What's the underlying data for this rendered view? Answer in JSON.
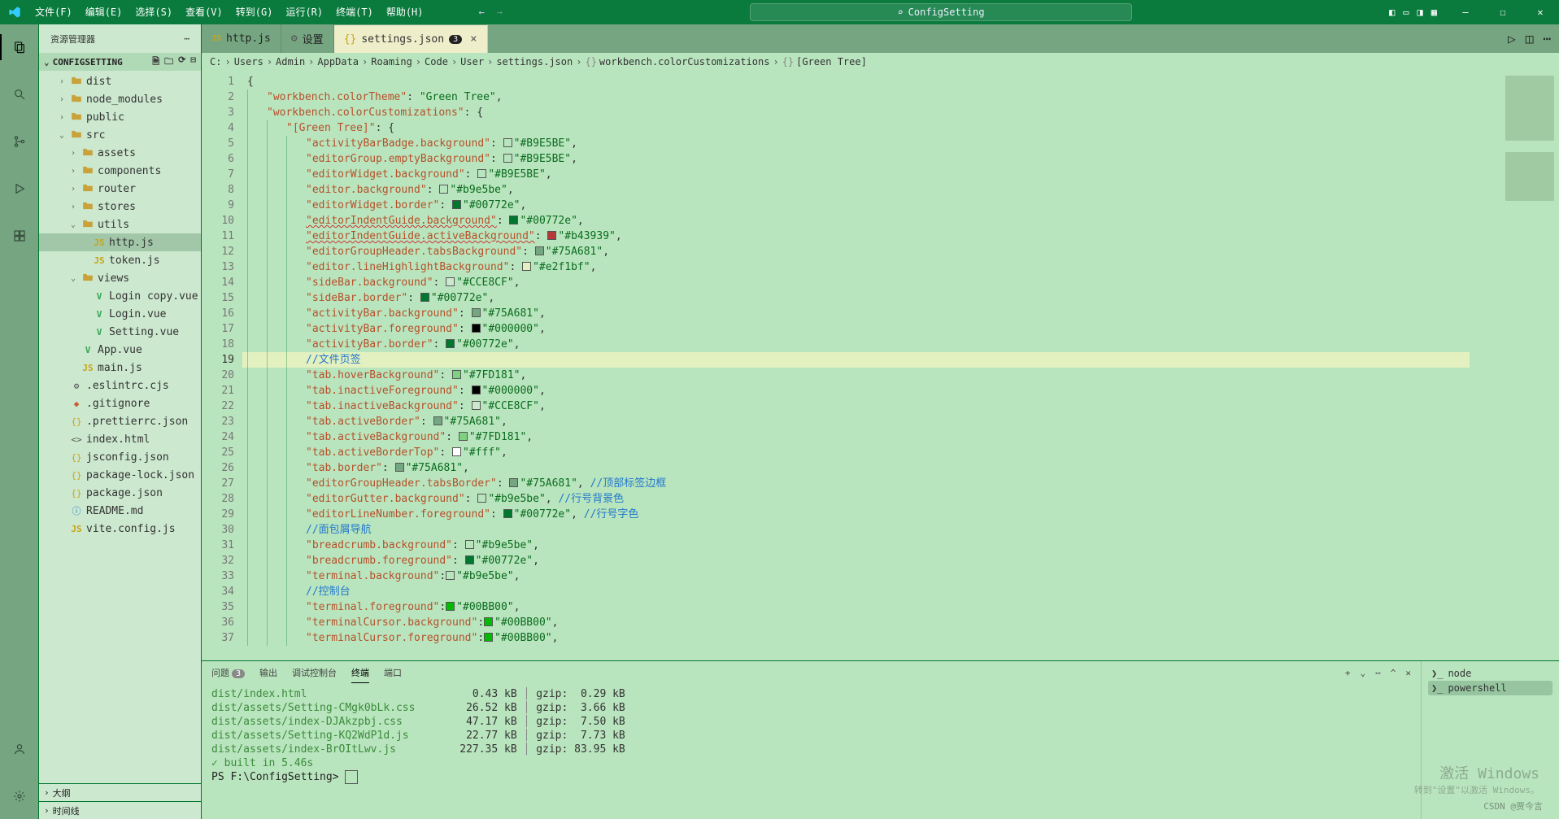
{
  "title": "ConfigSetting",
  "menu": [
    "文件(F)",
    "编辑(E)",
    "选择(S)",
    "查看(V)",
    "转到(G)",
    "运行(R)",
    "终端(T)",
    "帮助(H)"
  ],
  "sidebar": {
    "title": "资源管理器",
    "section": "CONFIGSETTING",
    "collapse1": "大纲",
    "collapse2": "时间线"
  },
  "tree": [
    {
      "d": 1,
      "exp": false,
      "icon": "folder",
      "label": "dist",
      "kind": "fi-folder"
    },
    {
      "d": 1,
      "exp": false,
      "icon": "folder",
      "label": "node_modules",
      "kind": "fi-folder"
    },
    {
      "d": 1,
      "exp": false,
      "icon": "folder",
      "label": "public",
      "kind": "fi-folder"
    },
    {
      "d": 1,
      "exp": true,
      "icon": "folder",
      "label": "src",
      "kind": "fi-folder"
    },
    {
      "d": 2,
      "exp": false,
      "icon": "folder",
      "label": "assets",
      "kind": "fi-folder"
    },
    {
      "d": 2,
      "exp": false,
      "icon": "folder",
      "label": "components",
      "kind": "fi-folder"
    },
    {
      "d": 2,
      "exp": false,
      "icon": "folder",
      "label": "router",
      "kind": "fi-folder"
    },
    {
      "d": 2,
      "exp": false,
      "icon": "folder",
      "label": "stores",
      "kind": "fi-folder"
    },
    {
      "d": 2,
      "exp": true,
      "icon": "folder",
      "label": "utils",
      "kind": "fi-folder"
    },
    {
      "d": 3,
      "icon": "JS",
      "label": "http.js",
      "kind": "fi-js",
      "sel": true
    },
    {
      "d": 3,
      "icon": "JS",
      "label": "token.js",
      "kind": "fi-js"
    },
    {
      "d": 2,
      "exp": true,
      "icon": "folder",
      "label": "views",
      "kind": "fi-folder"
    },
    {
      "d": 3,
      "icon": "V",
      "label": "Login copy.vue",
      "kind": "fi-vue"
    },
    {
      "d": 3,
      "icon": "V",
      "label": "Login.vue",
      "kind": "fi-vue"
    },
    {
      "d": 3,
      "icon": "V",
      "label": "Setting.vue",
      "kind": "fi-vue"
    },
    {
      "d": 2,
      "icon": "V",
      "label": "App.vue",
      "kind": "fi-vue"
    },
    {
      "d": 2,
      "icon": "JS",
      "label": "main.js",
      "kind": "fi-js"
    },
    {
      "d": 1,
      "icon": "⚙",
      "label": ".eslintrc.cjs",
      "kind": "fi-cfg"
    },
    {
      "d": 1,
      "icon": "◆",
      "label": ".gitignore",
      "kind": "fi-git"
    },
    {
      "d": 1,
      "icon": "{}",
      "label": ".prettierrc.json",
      "kind": "fi-json"
    },
    {
      "d": 1,
      "icon": "<>",
      "label": "index.html",
      "kind": "fi-cfg"
    },
    {
      "d": 1,
      "icon": "{}",
      "label": "jsconfig.json",
      "kind": "fi-json"
    },
    {
      "d": 1,
      "icon": "{}",
      "label": "package-lock.json",
      "kind": "fi-json"
    },
    {
      "d": 1,
      "icon": "{}",
      "label": "package.json",
      "kind": "fi-json"
    },
    {
      "d": 1,
      "icon": "ⓘ",
      "label": "README.md",
      "kind": "fi-info"
    },
    {
      "d": 1,
      "icon": "JS",
      "label": "vite.config.js",
      "kind": "fi-js"
    }
  ],
  "tabs": [
    {
      "icon": "JS",
      "label": "http.js",
      "kind": "fi-js"
    },
    {
      "icon": "⚙",
      "label": "设置",
      "kind": "fi-cfg"
    },
    {
      "icon": "{}",
      "label": "settings.json",
      "kind": "fi-json",
      "badge": "3",
      "active": true
    }
  ],
  "breadcrumb": [
    "C:",
    "Users",
    "Admin",
    "AppData",
    "Roaming",
    "Code",
    "User",
    "settings.json",
    "workbench.colorCustomizations",
    "[Green Tree]"
  ],
  "code": [
    {
      "n": 1,
      "ind": 0,
      "parts": [
        [
          "punc",
          "{"
        ]
      ]
    },
    {
      "n": 2,
      "ind": 1,
      "parts": [
        [
          "key",
          "\"workbench.colorTheme\""
        ],
        [
          "punc",
          ": "
        ],
        [
          "str",
          "\"Green Tree\""
        ],
        [
          "punc",
          ","
        ]
      ]
    },
    {
      "n": 3,
      "ind": 1,
      "parts": [
        [
          "key",
          "\"workbench.colorCustomizations\""
        ],
        [
          "punc",
          ": {"
        ]
      ]
    },
    {
      "n": 4,
      "ind": 2,
      "parts": [
        [
          "key",
          "\"[Green Tree]\""
        ],
        [
          "punc",
          ": {"
        ]
      ],
      "cursor": true
    },
    {
      "n": 5,
      "ind": 3,
      "parts": [
        [
          "key",
          "\"activityBarBadge.background\""
        ],
        [
          "punc",
          ": "
        ],
        [
          "sw",
          "#B9E5BE"
        ],
        [
          "str",
          "\"#B9E5BE\""
        ],
        [
          "punc",
          ","
        ]
      ]
    },
    {
      "n": 6,
      "ind": 3,
      "parts": [
        [
          "key",
          "\"editorGroup.emptyBackground\""
        ],
        [
          "punc",
          ": "
        ],
        [
          "sw",
          "#B9E5BE"
        ],
        [
          "str",
          "\"#B9E5BE\""
        ],
        [
          "punc",
          ","
        ]
      ]
    },
    {
      "n": 7,
      "ind": 3,
      "parts": [
        [
          "key",
          "\"editorWidget.background\""
        ],
        [
          "punc",
          ": "
        ],
        [
          "sw",
          "#B9E5BE"
        ],
        [
          "str",
          "\"#B9E5BE\""
        ],
        [
          "punc",
          ","
        ]
      ]
    },
    {
      "n": 8,
      "ind": 3,
      "parts": [
        [
          "key",
          "\"editor.background\""
        ],
        [
          "punc",
          ": "
        ],
        [
          "sw",
          "#b9e5be"
        ],
        [
          "str",
          "\"#b9e5be\""
        ],
        [
          "punc",
          ","
        ]
      ]
    },
    {
      "n": 9,
      "ind": 3,
      "parts": [
        [
          "key",
          "\"editorWidget.border\""
        ],
        [
          "punc",
          ": "
        ],
        [
          "sw",
          "#00772e"
        ],
        [
          "str",
          "\"#00772e\""
        ],
        [
          "punc",
          ","
        ]
      ]
    },
    {
      "n": 10,
      "ind": 3,
      "parts": [
        [
          "keysq",
          "\"editorIndentGuide.background\""
        ],
        [
          "punc",
          ": "
        ],
        [
          "sw",
          "#00772e"
        ],
        [
          "str",
          "\"#00772e\""
        ],
        [
          "punc",
          ","
        ]
      ]
    },
    {
      "n": 11,
      "ind": 3,
      "parts": [
        [
          "keysq",
          "\"editorIndentGuide.activeBackground\""
        ],
        [
          "punc",
          ": "
        ],
        [
          "sw",
          "#b43939"
        ],
        [
          "str",
          "\"#b43939\""
        ],
        [
          "punc",
          ","
        ]
      ]
    },
    {
      "n": 12,
      "ind": 3,
      "parts": [
        [
          "key",
          "\"editorGroupHeader.tabsBackground\""
        ],
        [
          "punc",
          ": "
        ],
        [
          "sw",
          "#75A681"
        ],
        [
          "str",
          "\"#75A681\""
        ],
        [
          "punc",
          ","
        ]
      ]
    },
    {
      "n": 13,
      "ind": 3,
      "parts": [
        [
          "key",
          "\"editor.lineHighlightBackground\""
        ],
        [
          "punc",
          ": "
        ],
        [
          "sw",
          "#e2f1bf"
        ],
        [
          "str",
          "\"#e2f1bf\""
        ],
        [
          "punc",
          ","
        ]
      ]
    },
    {
      "n": 14,
      "ind": 3,
      "parts": [
        [
          "key",
          "\"sideBar.background\""
        ],
        [
          "punc",
          ": "
        ],
        [
          "sw",
          "#CCE8CF"
        ],
        [
          "str",
          "\"#CCE8CF\""
        ],
        [
          "punc",
          ","
        ]
      ]
    },
    {
      "n": 15,
      "ind": 3,
      "parts": [
        [
          "key",
          "\"sideBar.border\""
        ],
        [
          "punc",
          ": "
        ],
        [
          "sw",
          "#00772e"
        ],
        [
          "str",
          "\"#00772e\""
        ],
        [
          "punc",
          ","
        ]
      ]
    },
    {
      "n": 16,
      "ind": 3,
      "parts": [
        [
          "key",
          "\"activityBar.background\""
        ],
        [
          "punc",
          ": "
        ],
        [
          "sw",
          "#75A681"
        ],
        [
          "str",
          "\"#75A681\""
        ],
        [
          "punc",
          ","
        ]
      ]
    },
    {
      "n": 17,
      "ind": 3,
      "parts": [
        [
          "key",
          "\"activityBar.foreground\""
        ],
        [
          "punc",
          ": "
        ],
        [
          "sw",
          "#000000"
        ],
        [
          "str",
          "\"#000000\""
        ],
        [
          "punc",
          ","
        ]
      ]
    },
    {
      "n": 18,
      "ind": 3,
      "parts": [
        [
          "key",
          "\"activityBar.border\""
        ],
        [
          "punc",
          ": "
        ],
        [
          "sw",
          "#00772e"
        ],
        [
          "str",
          "\"#00772e\""
        ],
        [
          "punc",
          ","
        ]
      ]
    },
    {
      "n": 19,
      "ind": 3,
      "parts": [
        [
          "comment",
          "//文件页签"
        ]
      ],
      "hl": true
    },
    {
      "n": 20,
      "ind": 3,
      "parts": [
        [
          "key",
          "\"tab.hoverBackground\""
        ],
        [
          "punc",
          ": "
        ],
        [
          "sw",
          "#7FD181"
        ],
        [
          "str",
          "\"#7FD181\""
        ],
        [
          "punc",
          ","
        ]
      ]
    },
    {
      "n": 21,
      "ind": 3,
      "parts": [
        [
          "key",
          "\"tab.inactiveForeground\""
        ],
        [
          "punc",
          ": "
        ],
        [
          "sw",
          "#000000"
        ],
        [
          "str",
          "\"#000000\""
        ],
        [
          "punc",
          ","
        ]
      ]
    },
    {
      "n": 22,
      "ind": 3,
      "parts": [
        [
          "key",
          "\"tab.inactiveBackground\""
        ],
        [
          "punc",
          ": "
        ],
        [
          "sw",
          "#CCE8CF"
        ],
        [
          "str",
          "\"#CCE8CF\""
        ],
        [
          "punc",
          ","
        ]
      ]
    },
    {
      "n": 23,
      "ind": 3,
      "parts": [
        [
          "key",
          "\"tab.activeBorder\""
        ],
        [
          "punc",
          ": "
        ],
        [
          "sw",
          "#75A681"
        ],
        [
          "str",
          "\"#75A681\""
        ],
        [
          "punc",
          ","
        ]
      ]
    },
    {
      "n": 24,
      "ind": 3,
      "parts": [
        [
          "key",
          "\"tab.activeBackground\""
        ],
        [
          "punc",
          ": "
        ],
        [
          "sw",
          "#7FD181"
        ],
        [
          "str",
          "\"#7FD181\""
        ],
        [
          "punc",
          ","
        ]
      ]
    },
    {
      "n": 25,
      "ind": 3,
      "parts": [
        [
          "key",
          "\"tab.activeBorderTop\""
        ],
        [
          "punc",
          ": "
        ],
        [
          "sw",
          "#ffffff"
        ],
        [
          "str",
          "\"#fff\""
        ],
        [
          "punc",
          ","
        ]
      ]
    },
    {
      "n": 26,
      "ind": 3,
      "parts": [
        [
          "key",
          "\"tab.border\""
        ],
        [
          "punc",
          ": "
        ],
        [
          "sw",
          "#75A681"
        ],
        [
          "str",
          "\"#75A681\""
        ],
        [
          "punc",
          ","
        ]
      ]
    },
    {
      "n": 27,
      "ind": 3,
      "parts": [
        [
          "key",
          "\"editorGroupHeader.tabsBorder\""
        ],
        [
          "punc",
          ": "
        ],
        [
          "sw",
          "#75A681"
        ],
        [
          "str",
          "\"#75A681\""
        ],
        [
          "punc",
          ", "
        ],
        [
          "comment",
          "//顶部标签边框"
        ]
      ]
    },
    {
      "n": 28,
      "ind": 3,
      "parts": [
        [
          "key",
          "\"editorGutter.background\""
        ],
        [
          "punc",
          ": "
        ],
        [
          "sw",
          "#b9e5be"
        ],
        [
          "str",
          "\"#b9e5be\""
        ],
        [
          "punc",
          ", "
        ],
        [
          "comment",
          "//行号背景色"
        ]
      ]
    },
    {
      "n": 29,
      "ind": 3,
      "parts": [
        [
          "key",
          "\"editorLineNumber.foreground\""
        ],
        [
          "punc",
          ": "
        ],
        [
          "sw",
          "#00772e"
        ],
        [
          "str",
          "\"#00772e\""
        ],
        [
          "punc",
          ", "
        ],
        [
          "comment",
          "//行号字色"
        ]
      ]
    },
    {
      "n": 30,
      "ind": 3,
      "parts": [
        [
          "comment",
          "//面包屑导航"
        ]
      ]
    },
    {
      "n": 31,
      "ind": 3,
      "parts": [
        [
          "key",
          "\"breadcrumb.background\""
        ],
        [
          "punc",
          ": "
        ],
        [
          "sw",
          "#b9e5be"
        ],
        [
          "str",
          "\"#b9e5be\""
        ],
        [
          "punc",
          ","
        ]
      ]
    },
    {
      "n": 32,
      "ind": 3,
      "parts": [
        [
          "key",
          "\"breadcrumb.foreground\""
        ],
        [
          "punc",
          ": "
        ],
        [
          "sw",
          "#00772e"
        ],
        [
          "str",
          "\"#00772e\""
        ],
        [
          "punc",
          ","
        ]
      ]
    },
    {
      "n": 33,
      "ind": 3,
      "parts": [
        [
          "key",
          "\"terminal.background\""
        ],
        [
          "punc",
          ":"
        ],
        [
          "sw",
          "#b9e5be"
        ],
        [
          "str",
          "\"#b9e5be\""
        ],
        [
          "punc",
          ","
        ]
      ]
    },
    {
      "n": 34,
      "ind": 3,
      "parts": [
        [
          "comment",
          "//控制台"
        ]
      ]
    },
    {
      "n": 35,
      "ind": 3,
      "parts": [
        [
          "key",
          "\"terminal.foreground\""
        ],
        [
          "punc",
          ":"
        ],
        [
          "sw",
          "#00BB00"
        ],
        [
          "str",
          "\"#00BB00\""
        ],
        [
          "punc",
          ","
        ]
      ]
    },
    {
      "n": 36,
      "ind": 3,
      "parts": [
        [
          "key",
          "\"terminalCursor.background\""
        ],
        [
          "punc",
          ":"
        ],
        [
          "sw",
          "#00BB00"
        ],
        [
          "str",
          "\"#00BB00\""
        ],
        [
          "punc",
          ","
        ]
      ]
    },
    {
      "n": 37,
      "ind": 3,
      "parts": [
        [
          "key",
          "\"terminalCursor.foreground\""
        ],
        [
          "punc",
          ":"
        ],
        [
          "sw",
          "#00BB00"
        ],
        [
          "str",
          "\"#00BB00\""
        ],
        [
          "punc",
          ","
        ]
      ]
    }
  ],
  "panel": {
    "tabs": {
      "problems": "问题",
      "problems_badge": "3",
      "output": "输出",
      "debug": "调试控制台",
      "terminal": "终端",
      "ports": "端口"
    },
    "terminals": [
      {
        "name": "node"
      },
      {
        "name": "powershell",
        "sel": true
      }
    ],
    "lines": [
      {
        "path": "dist/index.html",
        "size": "0.43 kB",
        "gzip": "gzip:  0.29 kB"
      },
      {
        "path": "dist/assets/Setting-CMgk0bLk.css",
        "size": "26.52 kB",
        "gzip": "gzip:  3.66 kB"
      },
      {
        "path": "dist/assets/index-DJAkzpbj.css",
        "size": "47.17 kB",
        "gzip": "gzip:  7.50 kB"
      },
      {
        "path": "dist/assets/Setting-KQ2WdP1d.js",
        "size": "22.77 kB",
        "gzip": "gzip:  7.73 kB"
      },
      {
        "path": "dist/assets/index-BrOItLwv.js",
        "size": "227.35 kB",
        "gzip": "gzip: 83.95 kB"
      }
    ],
    "built": "✓ built in 5.46s",
    "prompt": "PS F:\\ConfigSetting> "
  },
  "watermark": {
    "t1": "激活 Windows",
    "t2": "转到\"设置\"以激活 Windows。"
  },
  "csdn": "CSDN @贾今言"
}
